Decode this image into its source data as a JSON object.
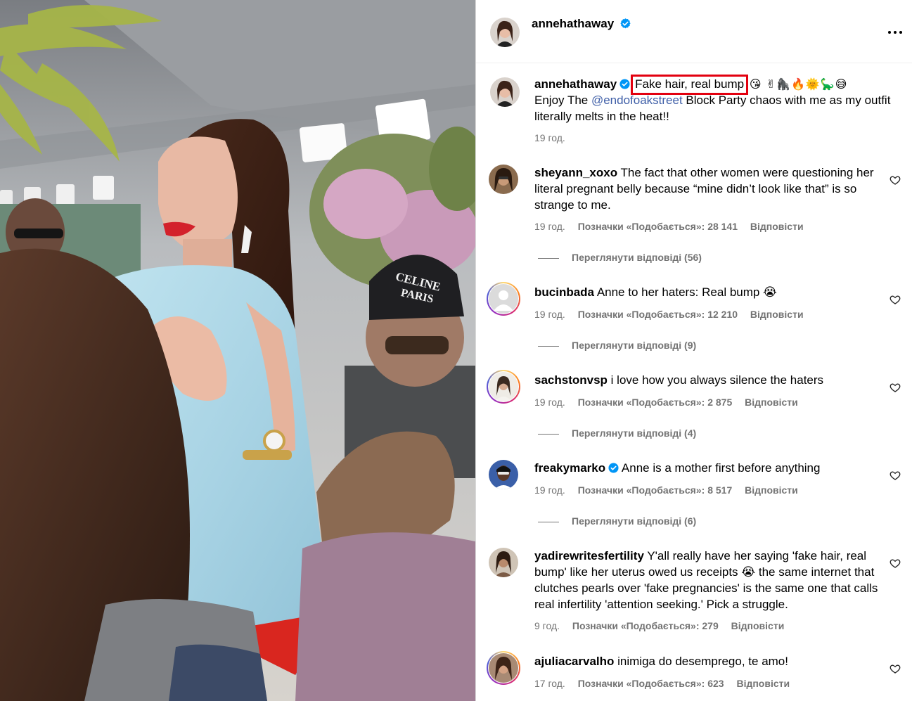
{
  "post": {
    "author": "annehathaway",
    "caption_highlight": "Fake hair, real bump",
    "caption_emojis": "😘 ✌🦍🔥🌞🦕😅",
    "caption_prefix": "Enjoy The ",
    "caption_mention": "@endofoakstreet",
    "caption_suffix": " Block Party chaos with me as my outfit literally melts in the heat!!",
    "time": "19 год."
  },
  "photo": {
    "cap_text_line1": "CELINE",
    "cap_text_line2": "PARIS"
  },
  "comments": [
    {
      "user": "sheyann_xoxo",
      "verified": false,
      "text": "The fact that other women were questioning her literal pregnant belly because “mine didn’t look like that” is so strange to me.",
      "time": "19 год.",
      "likes": "Позначки «Подобається»: 28 141",
      "reply": "Відповісти",
      "replies": "Переглянути відповіді (56)"
    },
    {
      "user": "bucinbada",
      "verified": false,
      "text": "Anne to her haters: Real bump 😭",
      "time": "19 год.",
      "likes": "Позначки «Подобається»: 12 210",
      "reply": "Відповісти",
      "replies": "Переглянути відповіді (9)"
    },
    {
      "user": "sachstonvsp",
      "verified": false,
      "text": "i love how you always silence the haters",
      "time": "19 год.",
      "likes": "Позначки «Подобається»: 2 875",
      "reply": "Відповісти",
      "replies": "Переглянути відповіді (4)"
    },
    {
      "user": "freakymarko",
      "verified": true,
      "text": "Anne is a mother first before anything",
      "time": "19 год.",
      "likes": "Позначки «Подобається»: 8 517",
      "reply": "Відповісти",
      "replies": "Переглянути відповіді (6)"
    },
    {
      "user": "yadirewritesfertility",
      "verified": false,
      "text": "Y'all really have her saying 'fake hair, real bump' like her uterus owed us receipts 😭 the same internet that clutches pearls over 'fake pregnancies' is the same one that calls real infertility 'attention seeking.' Pick a struggle.",
      "time": "9 год.",
      "likes": "Позначки «Подобається»: 279",
      "reply": "Відповісти",
      "replies": ""
    },
    {
      "user": "ajuliacarvalho",
      "verified": false,
      "text": "inimiga do desemprego, te amo!",
      "time": "17 год.",
      "likes": "Позначки «Подобається»: 623",
      "reply": "Відповісти",
      "replies": ""
    }
  ],
  "colors": {
    "accent_link": "#3e5ea7",
    "highlight_box": "#e3000f",
    "verified_badge": "#0095f6",
    "muted_text": "#737373"
  }
}
